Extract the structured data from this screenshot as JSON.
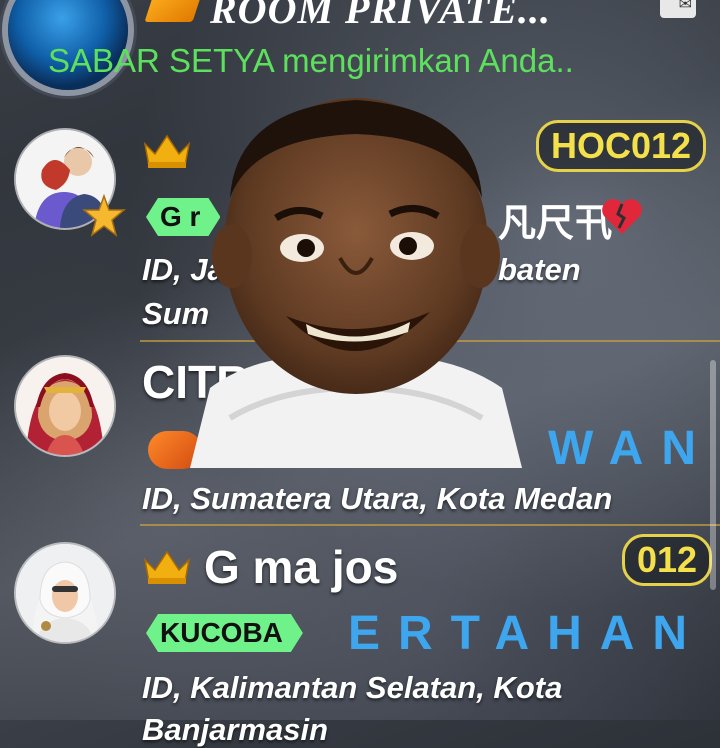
{
  "header": {
    "room_title": "ROOM PRIVATE...",
    "notification": "SABAR SETYA mengirimkan Anda.."
  },
  "users": [
    {
      "name": "",
      "name_visible_prefix": "",
      "tag": "HOC012",
      "pill": "G r",
      "decor_text": "凡尺卂",
      "location_line1": "ID, Ja",
      "location_line1_tail": "baten",
      "location_line2": "Sum"
    },
    {
      "name": "CITR",
      "tag": "",
      "spaced_text": "WAN",
      "location_line1": "ID, Sumatera Utara, Kota Medan"
    },
    {
      "name": "G ma jos",
      "tag": "012",
      "pill": "KUCOBA",
      "spaced_text": "ERTAHAN",
      "location_line1": "ID, Kalimantan Selatan, Kota",
      "location_line2": "Banjarmasin"
    }
  ],
  "colors": {
    "notice_green": "#5de05d",
    "tag_yellow": "#f4e04a",
    "pill_green": "#6ff28a",
    "spaced_blue": "#3da6ee",
    "divider_gold": "#c8a040"
  },
  "icons": [
    "crown-icon",
    "star-icon",
    "broken-heart-icon",
    "message-icon"
  ]
}
